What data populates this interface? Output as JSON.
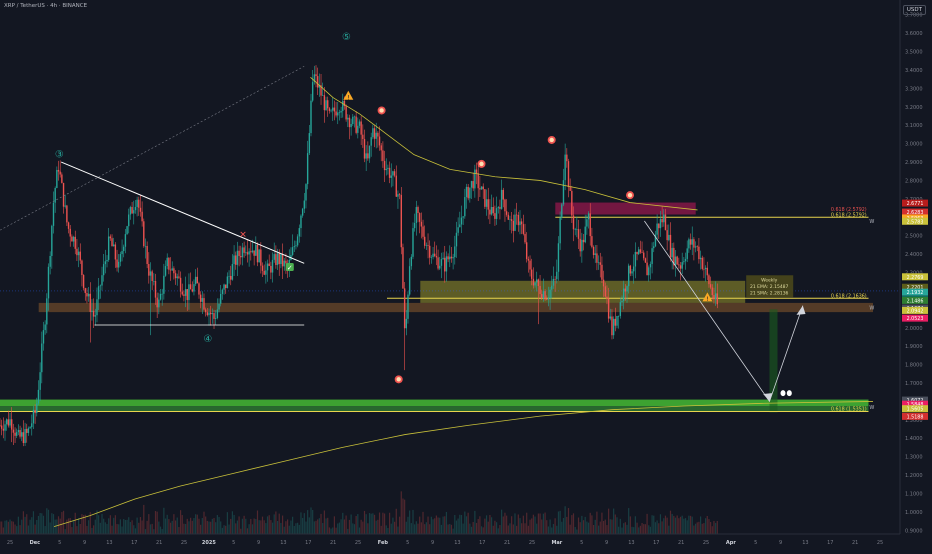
{
  "header": {
    "symbol_title": "XRP / TetherUS · 4h · BINANCE",
    "currency_button": "USDT"
  },
  "colors": {
    "background": "#131722",
    "candle_up": "#26a69a",
    "candle_down": "#ef5350",
    "ema_line": "#c9c13a",
    "trendline": "#ffffff",
    "support_band": "#8a5a2b",
    "green_band": "#4cd137",
    "yellow_zone": "#8f8a2a",
    "red_zone": "#c2185b",
    "wave_label": "#26a69a"
  },
  "chart_data": {
    "type": "candlestick",
    "price_axis": {
      "ticks": [
        "3.7000",
        "3.6000",
        "3.5000",
        "3.4000",
        "3.3000",
        "3.2000",
        "3.1000",
        "3.0000",
        "2.9000",
        "2.8000",
        "2.7000",
        "2.6000",
        "2.5000",
        "2.4000",
        "2.3000",
        "2.2000",
        "2.1000",
        "2.0000",
        "1.9000",
        "1.8000",
        "1.7000",
        "1.6000",
        "1.5000",
        "1.4000",
        "1.3000",
        "1.2000",
        "1.1000",
        "1.0000",
        "0.9000"
      ],
      "ylim": [
        0.88,
        3.78
      ]
    },
    "time_axis": {
      "ticks": [
        "25",
        "Dec",
        "5",
        "9",
        "13",
        "17",
        "21",
        "25",
        "2025",
        "5",
        "9",
        "13",
        "17",
        "21",
        "25",
        "Feb",
        "5",
        "9",
        "13",
        "17",
        "21",
        "25",
        "Mar",
        "5",
        "9",
        "13",
        "17",
        "21",
        "25",
        "Apr",
        "5",
        "9",
        "13",
        "17",
        "21",
        "25"
      ]
    },
    "price_labels": [
      {
        "value": 2.6771,
        "text": "2.6771",
        "bg": "#b71c1c"
      },
      {
        "value": 2.6283,
        "text": "2.6283",
        "bg": "#d32f2f"
      },
      {
        "value": 2.5963,
        "text": "2.5963",
        "bg": "#f9a825"
      },
      {
        "value": 2.5783,
        "text": "2.5783",
        "bg": "#c9c13a"
      },
      {
        "value": 2.2769,
        "text": "2.2769",
        "bg": "#c9c13a"
      },
      {
        "value": 2.2201,
        "text": "2.2201",
        "bg": "#5d5d1a"
      },
      {
        "value": 2.1932,
        "text": "2.1932",
        "bg": "#26a69a"
      },
      {
        "value": 2.1519,
        "text": "2.1519",
        "bg": "#089981"
      },
      {
        "value": 2.1486,
        "text": "2.1486",
        "bg": "#2e7d32"
      },
      {
        "value": 2.1074,
        "text": "2.1074",
        "bg": "#4a4f5c"
      },
      {
        "value": 2.0942,
        "text": "2.0942",
        "bg": "#c9c13a"
      },
      {
        "value": 2.0523,
        "text": "2.0523",
        "bg": "#e91e63"
      },
      {
        "value": 1.6072,
        "text": "1.6072",
        "bg": "#4a4f5c"
      },
      {
        "value": 1.5848,
        "text": "1.5848",
        "bg": "#e91e63"
      },
      {
        "value": 1.5605,
        "text": "1.5605",
        "bg": "#c9c13a"
      },
      {
        "value": 1.5188,
        "text": "1.5188",
        "bg": "#d32f2f"
      }
    ],
    "fib_labels": [
      {
        "value": 2.63,
        "text": "0.618 (2.5792)"
      },
      {
        "value": 2.6,
        "text": "0.618 (2.5792)"
      },
      {
        "value": 2.16,
        "text": "0.618 (2.1636)"
      },
      {
        "value": 1.545,
        "text": "0.618 (1.5351)"
      }
    ],
    "wave_labels": [
      {
        "text": "③",
        "x_frac": 0.066,
        "value": 2.94
      },
      {
        "text": "④",
        "x_frac": 0.231,
        "value": 1.94
      },
      {
        "text": "⑤",
        "x_frac": 0.385,
        "value": 3.58
      }
    ],
    "weekly_box": {
      "title": "Weekly",
      "ema": "21 EMA: 2.15487",
      "sma": "21 SMA: 2.28136"
    },
    "line_end_labels": [
      {
        "text": "W",
        "value": 2.58
      },
      {
        "text": "W",
        "value": 2.11
      },
      {
        "text": "W",
        "value": 1.57
      }
    ]
  }
}
